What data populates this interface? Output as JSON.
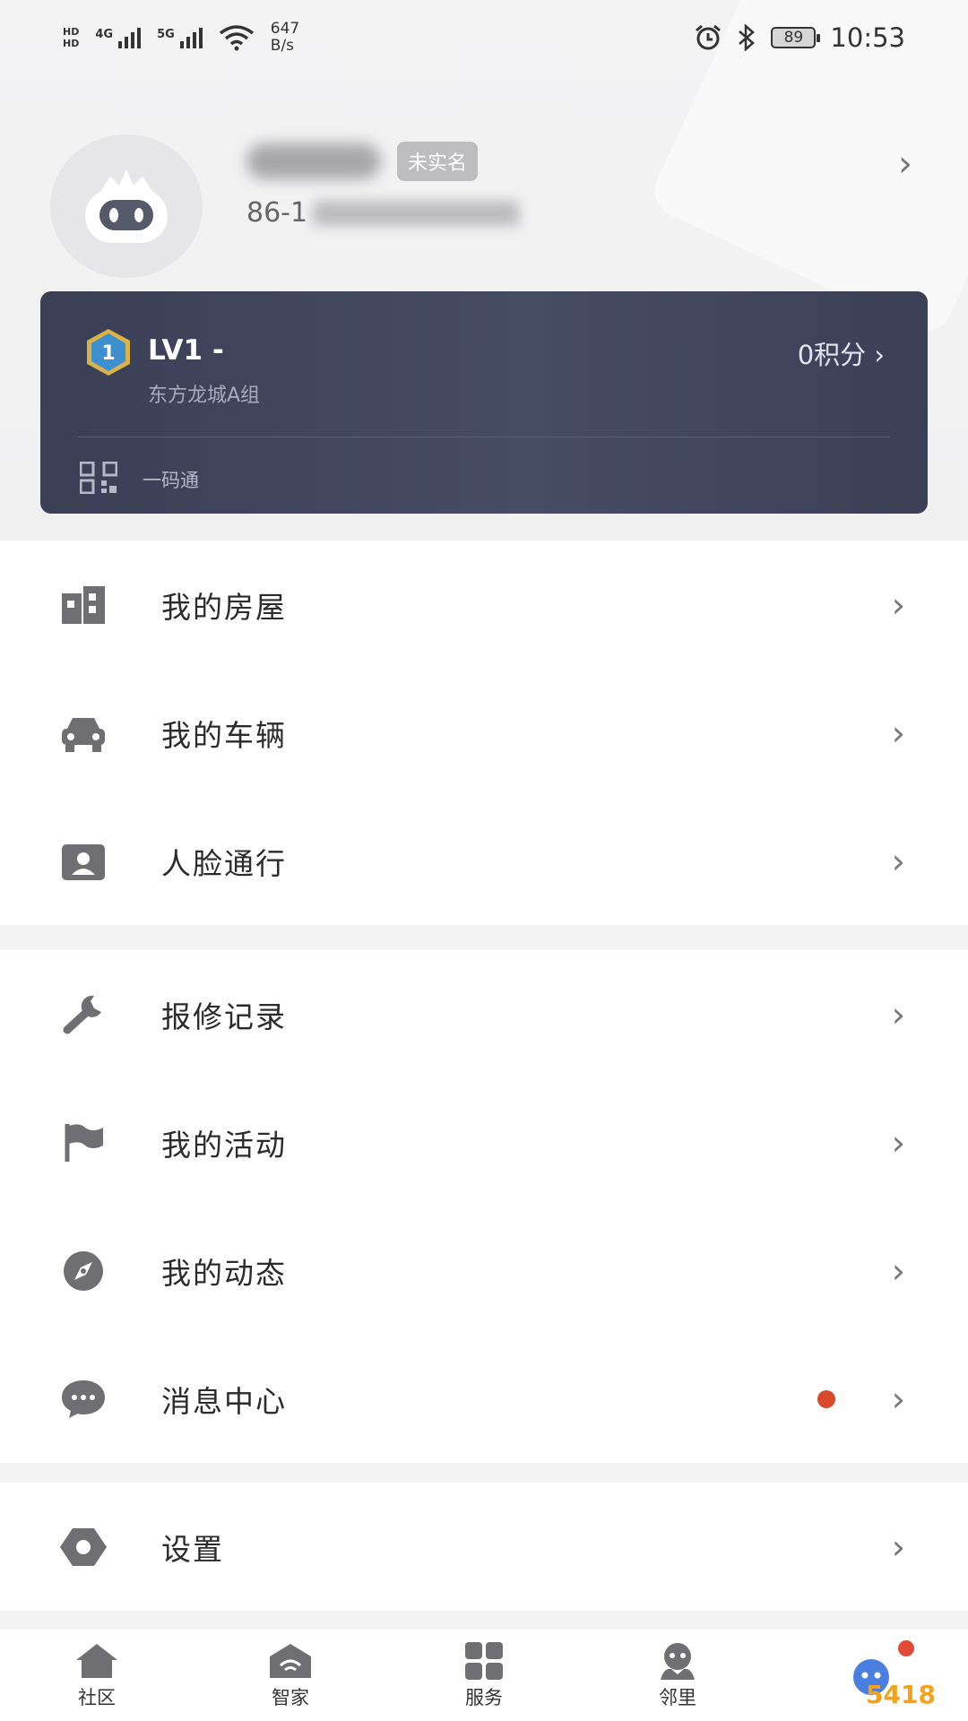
{
  "status_bar": {
    "hd1": "HD",
    "hd2": "HD",
    "sig1": "4G",
    "sig2": "5G",
    "speed_value": "647",
    "speed_unit": "B/s",
    "battery": "89",
    "time": "10:53"
  },
  "profile": {
    "badge": "未实名",
    "phone_prefix": "86-1"
  },
  "level_card": {
    "level_text": "LV1 -",
    "group": "东方龙城A组",
    "points": "0积分",
    "qr_label": "一码通"
  },
  "menu": {
    "group1": [
      {
        "label": "我的房屋",
        "icon": "building-icon"
      },
      {
        "label": "我的车辆",
        "icon": "car-icon"
      },
      {
        "label": "人脸通行",
        "icon": "face-id-icon"
      }
    ],
    "group2": [
      {
        "label": "报修记录",
        "icon": "wrench-icon"
      },
      {
        "label": "我的活动",
        "icon": "flag-icon"
      },
      {
        "label": "我的动态",
        "icon": "compass-icon"
      },
      {
        "label": "消息中心",
        "icon": "chat-bubble-icon",
        "has_dot": true
      }
    ],
    "group3": [
      {
        "label": "设置",
        "icon": "settings-hexagon-icon"
      }
    ]
  },
  "bottom_nav": [
    {
      "label": "社区",
      "icon": "home-icon"
    },
    {
      "label": "智家",
      "icon": "smart-home-icon"
    },
    {
      "label": "服务",
      "icon": "grid-icon"
    },
    {
      "label": "邻里",
      "icon": "neighbor-icon"
    },
    {
      "label": "",
      "icon": "mascot-icon"
    }
  ],
  "watermark": "5418",
  "colors": {
    "card_bg": "#3a3f56",
    "icon_gray": "#6f6f73",
    "notification_red": "#d84a2b"
  }
}
